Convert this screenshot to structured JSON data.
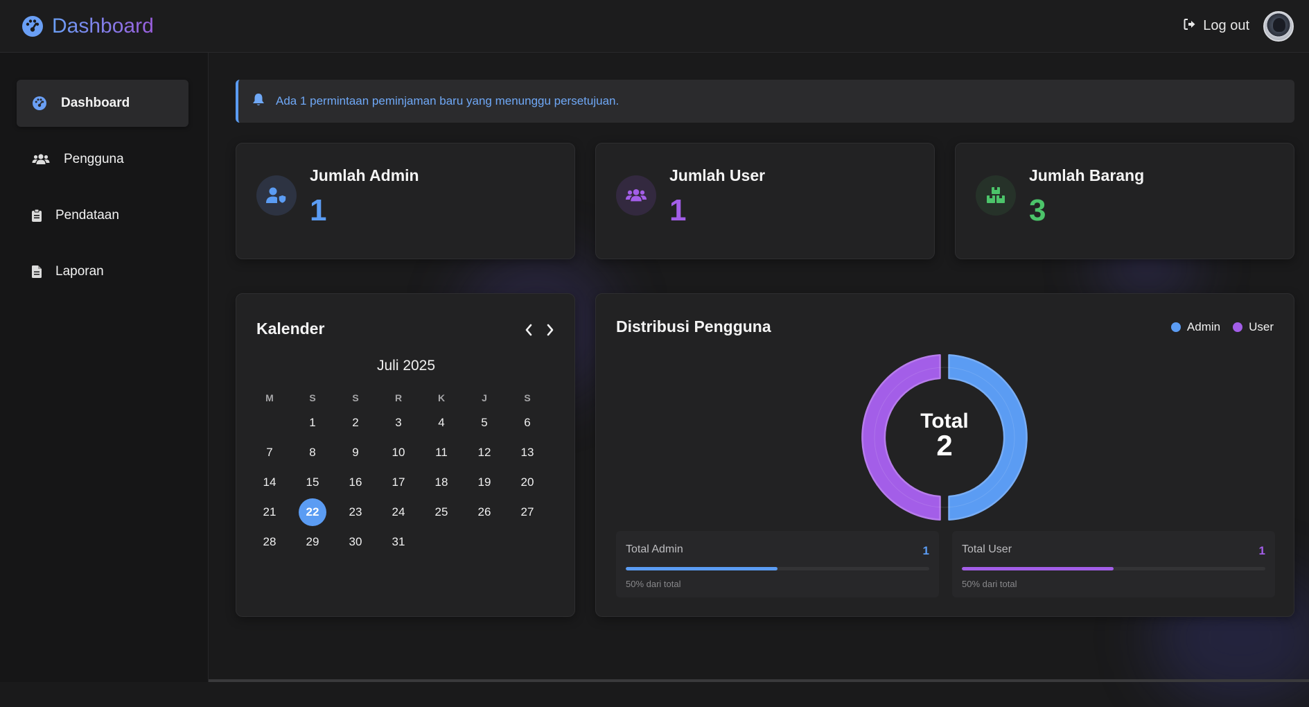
{
  "header": {
    "title": "Dashboard",
    "logout_label": "Log out"
  },
  "sidebar": {
    "items": [
      {
        "label": "Dashboard",
        "icon": "gauge-icon",
        "active": true
      },
      {
        "label": "Pengguna",
        "icon": "users-icon",
        "active": false
      },
      {
        "label": "Pendataan",
        "icon": "clipboard-icon",
        "active": false
      },
      {
        "label": "Laporan",
        "icon": "file-icon",
        "active": false
      }
    ]
  },
  "alert": {
    "icon": "bell-icon",
    "text": "Ada 1 permintaan peminjaman baru yang menunggu persetujuan."
  },
  "stats": [
    {
      "title": "Jumlah Admin",
      "value": "1",
      "icon": "user-shield-icon",
      "color": "#5b9cf3"
    },
    {
      "title": "Jumlah User",
      "value": "1",
      "icon": "users-icon",
      "color": "#a35ee8"
    },
    {
      "title": "Jumlah Barang",
      "value": "3",
      "icon": "boxes-icon",
      "color": "#4cc46a"
    }
  ],
  "calendar": {
    "title": "Kalender",
    "month_label": "Juli 2025",
    "weekdays": [
      "M",
      "S",
      "S",
      "R",
      "K",
      "J",
      "S"
    ],
    "first_weekday_index": 1,
    "days_in_month": 31,
    "today": 22
  },
  "distribution": {
    "title": "Distribusi Pengguna",
    "legend": [
      {
        "label": "Admin",
        "color": "#5b9cf3"
      },
      {
        "label": "User",
        "color": "#a35ee8"
      }
    ],
    "center_label": "Total",
    "center_value": "2",
    "breakdown": [
      {
        "label": "Total Admin",
        "value": "1",
        "note": "50% dari total",
        "fraction": 0.5,
        "color": "#5b9cf3"
      },
      {
        "label": "Total User",
        "value": "1",
        "note": "50% dari total",
        "fraction": 0.5,
        "color": "#a35ee8"
      }
    ]
  }
}
